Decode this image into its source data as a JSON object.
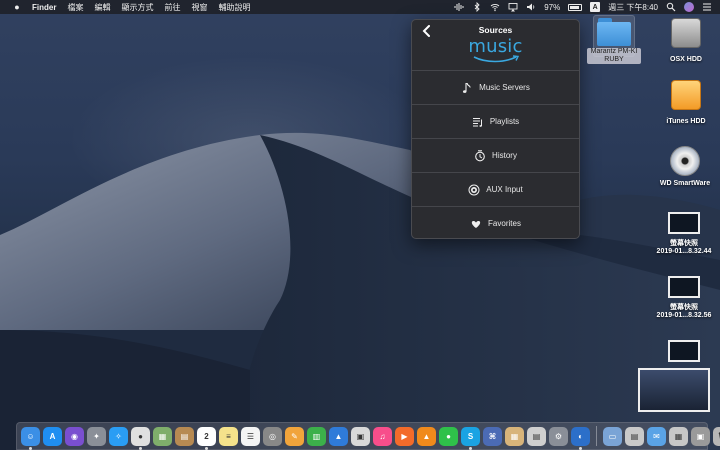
{
  "menubar": {
    "apple_icon": "apple-logo-icon",
    "app_name": "Finder",
    "menus": [
      "檔案",
      "編輯",
      "顯示方式",
      "前往",
      "視窗",
      "輔助說明"
    ],
    "battery_percent": "97%",
    "input_method": "A",
    "clock": "週三 下午8:40"
  },
  "popup": {
    "title": "Sources",
    "brand_text": "music",
    "brand_color": "#3aa8e0",
    "items": [
      {
        "label": "Music Servers",
        "icon": "music-note-icon"
      },
      {
        "label": "Playlists",
        "icon": "playlist-icon"
      },
      {
        "label": "History",
        "icon": "history-icon"
      },
      {
        "label": "AUX Input",
        "icon": "aux-input-icon"
      },
      {
        "label": "Favorites",
        "icon": "heart-icon"
      }
    ]
  },
  "desktop": {
    "icons": [
      {
        "label": "Marantz PM-KI RUBY",
        "type": "folder"
      },
      {
        "label": "OSX HDD",
        "type": "disk"
      },
      {
        "label": "iTunes HDD",
        "type": "disk"
      },
      {
        "label": "WD SmartWare",
        "type": "cd"
      },
      {
        "label_line1": "螢幕快照",
        "label_line2": "2019-01...8.32.44",
        "type": "screenshot"
      },
      {
        "label_line1": "螢幕快照",
        "label_line2": "2019-01...8.32.56",
        "type": "screenshot"
      }
    ]
  },
  "dock": {
    "apps": [
      {
        "name": "finder",
        "color": "#3b8fe6",
        "glyph": "☺"
      },
      {
        "name": "app-store",
        "color": "#1f8ef1",
        "glyph": "A"
      },
      {
        "name": "siri",
        "color": "#7a4fd0",
        "glyph": "◉"
      },
      {
        "name": "launchpad",
        "color": "#8a8f98",
        "glyph": "✦"
      },
      {
        "name": "safari",
        "color": "#2a9df4",
        "glyph": "✧"
      },
      {
        "name": "chrome",
        "color": "#e0e0e0",
        "glyph": "●"
      },
      {
        "name": "preview",
        "color": "#7fae6b",
        "glyph": "▦"
      },
      {
        "name": "notefile",
        "color": "#b78a52",
        "glyph": "▤"
      },
      {
        "name": "calendar",
        "color": "#ffffff",
        "glyph": "2"
      },
      {
        "name": "notes",
        "color": "#f5e28b",
        "glyph": "≡"
      },
      {
        "name": "reminders",
        "color": "#f4f4f4",
        "glyph": "☰"
      },
      {
        "name": "screenshot",
        "color": "#888888",
        "glyph": "◎"
      },
      {
        "name": "pages",
        "color": "#f1a43b",
        "glyph": "✎"
      },
      {
        "name": "numbers",
        "color": "#3cb04a",
        "glyph": "▥"
      },
      {
        "name": "keynote",
        "color": "#2f7bd9",
        "glyph": "▲"
      },
      {
        "name": "photo",
        "color": "#d9d9d9",
        "glyph": "▣"
      },
      {
        "name": "itunes",
        "color": "#f74e8b",
        "glyph": "♫"
      },
      {
        "name": "infuse",
        "color": "#f36b2a",
        "glyph": "▶"
      },
      {
        "name": "vlc",
        "color": "#f08a1c",
        "glyph": "▲"
      },
      {
        "name": "line",
        "color": "#2fc14a",
        "glyph": "●"
      },
      {
        "name": "skype",
        "color": "#1aa3e3",
        "glyph": "S"
      },
      {
        "name": "script",
        "color": "#4b6bb5",
        "glyph": "⌘"
      },
      {
        "name": "archive",
        "color": "#d8b47a",
        "glyph": "▦"
      },
      {
        "name": "text-editor",
        "color": "#cfcfcf",
        "glyph": "▤"
      },
      {
        "name": "system-preferences",
        "color": "#8a8f98",
        "glyph": "⚙"
      },
      {
        "name": "music-control",
        "color": "#2c6fc9",
        "glyph": "◐"
      },
      {
        "name": "image-capture",
        "color": "#7aa4d6",
        "glyph": "▭"
      },
      {
        "name": "downloads-stack",
        "color": "#c9c9c9",
        "glyph": "▤"
      },
      {
        "name": "mail-stack",
        "color": "#5aa3e6",
        "glyph": "✉"
      },
      {
        "name": "documents-stack",
        "color": "#c7c7c7",
        "glyph": "▦"
      },
      {
        "name": "photos-stack",
        "color": "#9a9a9a",
        "glyph": "▣"
      },
      {
        "name": "trash",
        "color": "#b7b7b7",
        "glyph": "🗑"
      }
    ]
  }
}
